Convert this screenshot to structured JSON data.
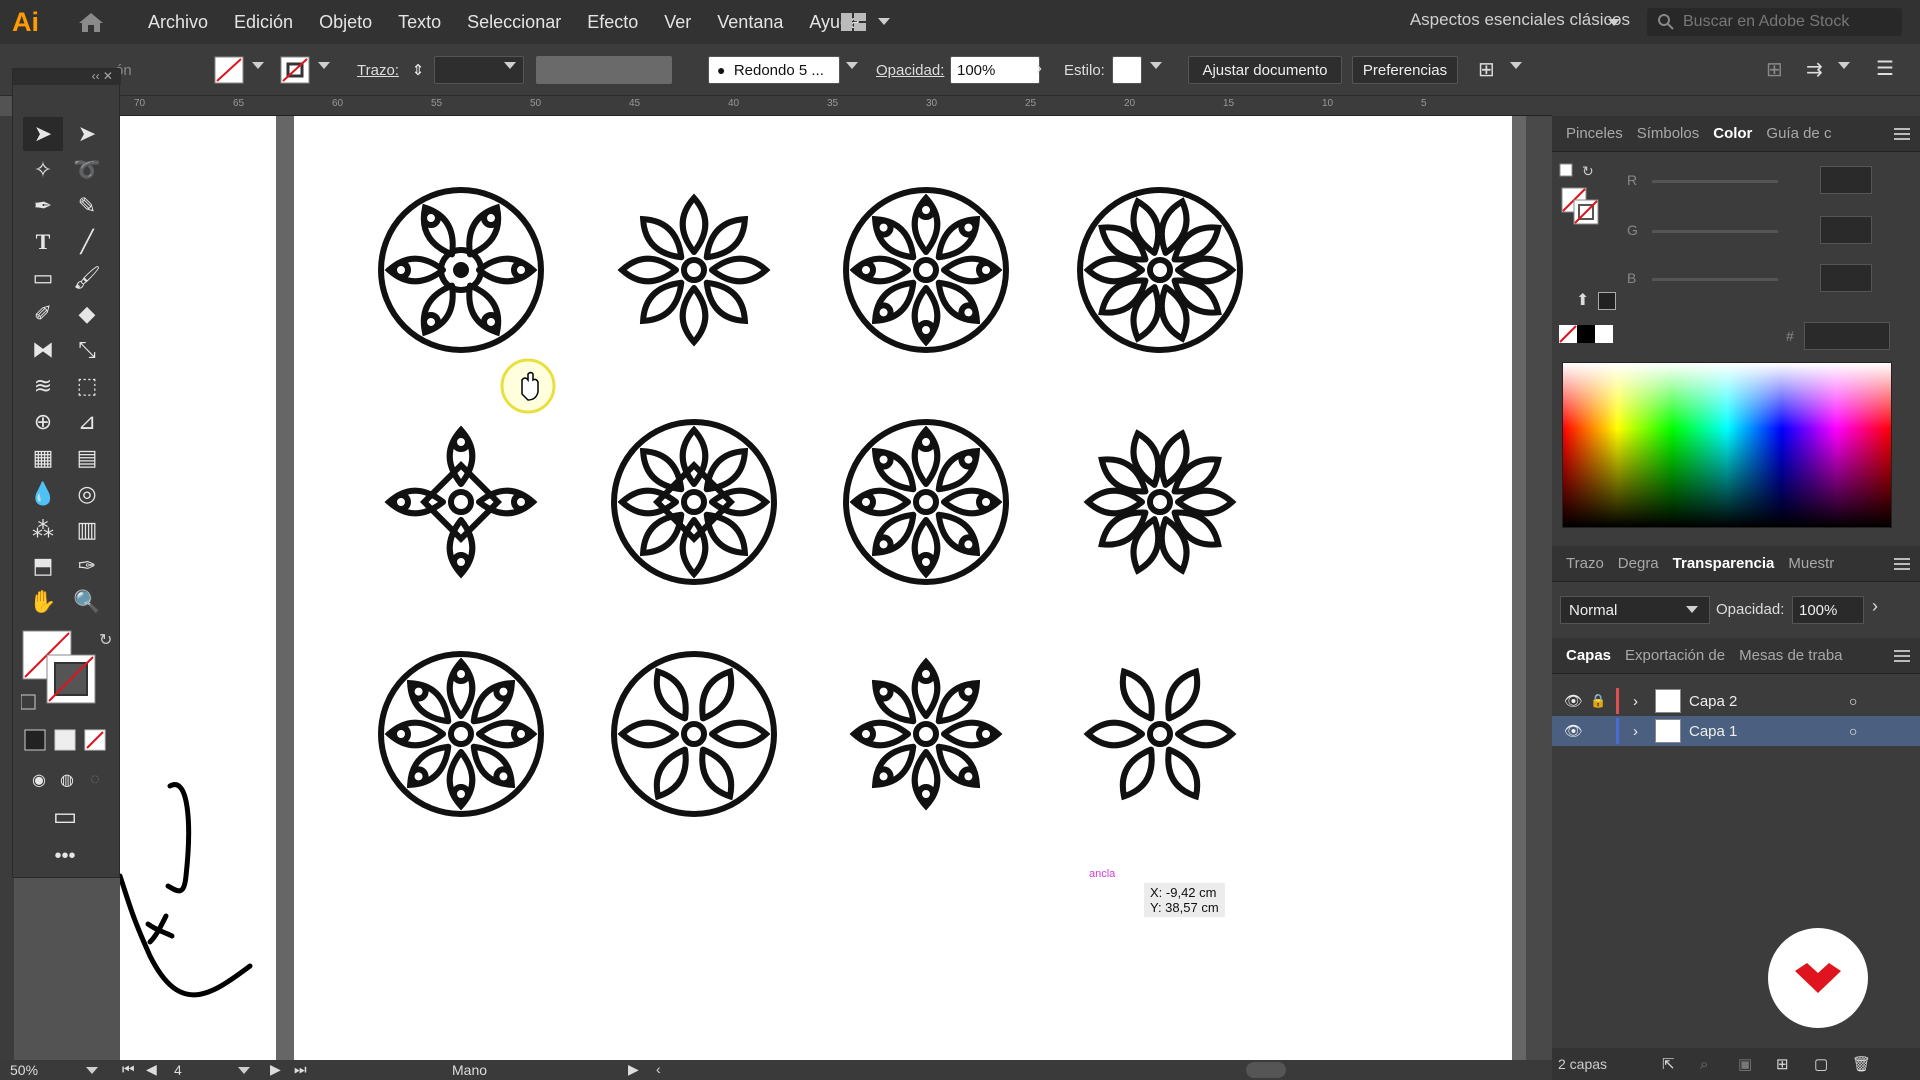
{
  "app": {
    "logo": "Ai"
  },
  "menu": [
    "Archivo",
    "Edición",
    "Objeto",
    "Texto",
    "Seleccionar",
    "Efecto",
    "Ver",
    "Ventana",
    "Ayuda"
  ],
  "workspace": "Aspectos esenciales clásicos",
  "stock_placeholder": "Buscar en Adobe Stock",
  "control": {
    "leading_label": "ón",
    "stroke_label": "Trazo:",
    "brush_value": "Redondo 5 ...",
    "opacity_label": "Opacidad:",
    "opacity_value": "100%",
    "style_label": "Estilo:",
    "fit_button": "Ajustar documento",
    "prefs_button": "Preferencias"
  },
  "ruler_ticks": [
    "70",
    "65",
    "60",
    "55",
    "50",
    "45",
    "40",
    "35",
    "30",
    "25",
    "20",
    "15",
    "10",
    "5"
  ],
  "cursor_readout": {
    "x": "X: -9,42 cm",
    "y": "Y: 38,57 cm"
  },
  "snap_label": "ancla",
  "panels": {
    "top_tabs": [
      "Pinceles",
      "Símbolos",
      "Color",
      "Guía de c"
    ],
    "active_top": "Color",
    "rgb_labels": [
      "R",
      "G",
      "B"
    ],
    "hex_label": "#",
    "mid_tabs": [
      "Trazo",
      "Degra",
      "Transparencia",
      "Muestr"
    ],
    "active_mid": "Transparencia",
    "blend_mode": "Normal",
    "opacity_label": "Opacidad:",
    "opacity_value": "100%",
    "bottom_tabs": [
      "Capas",
      "Exportación de",
      "Mesas de traba"
    ],
    "active_bottom": "Capas",
    "layers": [
      {
        "name": "Capa 2",
        "color": "#e05050"
      },
      {
        "name": "Capa 1",
        "color": "#4a6cd6"
      }
    ],
    "layer_count": "2 capas"
  },
  "status": {
    "zoom": "50%",
    "artboard": "4",
    "tool": "Mano"
  },
  "colors": {
    "accent_orange": "#ff9a00",
    "brand_red": "#e0141e"
  }
}
